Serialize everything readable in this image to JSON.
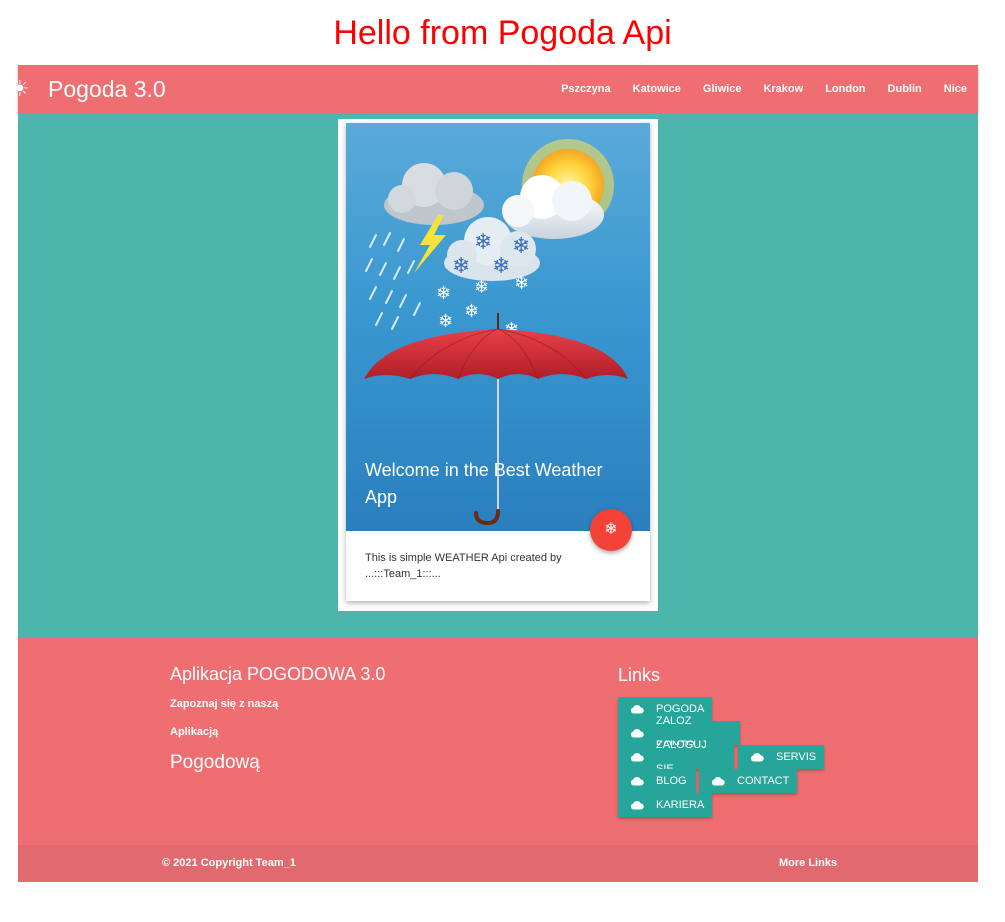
{
  "heading": "Hello from Pogoda Api",
  "navbar": {
    "brand_icon": "sun-icon",
    "brand": "Pogoda 3.0",
    "links": [
      "Pszczyna",
      "Katowice",
      "Gliwice",
      "Krakow",
      "London",
      "Dublin",
      "Nice"
    ]
  },
  "card": {
    "title": "Welcome in the Best Weather App",
    "fab_icon": "snowflake-icon",
    "content_line1": "This is simple WEATHER Api created by",
    "content_line2": "...:::Team_1:::..."
  },
  "footer": {
    "title": "Aplikacja POGODOWA 3.0",
    "paragraph1": "Zapoznaj się z naszą",
    "paragraph2": "Aplikacją",
    "paragraph3": "Pogodową",
    "links_title": "Links",
    "link_icon": "cloud-icon",
    "links": [
      "POGODA",
      "ZALOZ KONTO",
      "ZALOGUJ SIĘ",
      "SERVIS",
      "BLOG",
      "CONTACT",
      "KARIERA"
    ]
  },
  "copyright": {
    "text": "© 2021 Copyright Team_1",
    "more_links": "More Links"
  },
  "colors": {
    "heading": "#ff0000",
    "navbar": "#ef6e71",
    "main_bg": "#4db6ac",
    "footer": "#ef6e71",
    "copyright_bar": "#e26a6e",
    "link_button": "#26a69a",
    "fab": "#f44336"
  }
}
